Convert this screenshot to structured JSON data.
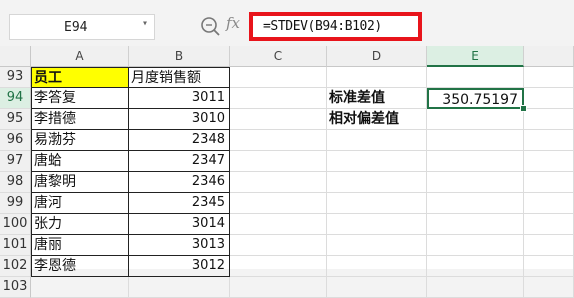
{
  "formula_bar": {
    "name_box": "E94",
    "fx_label": "fx",
    "formula": "=STDEV(B94:B102)"
  },
  "columns": [
    "A",
    "B",
    "C",
    "D",
    "E"
  ],
  "rows": [
    {
      "num": "93",
      "a": "员工",
      "b": "月度销售额",
      "d": "",
      "e": ""
    },
    {
      "num": "94",
      "a": "李答复",
      "b": "3011",
      "d": "标准差值",
      "e": "350.75197"
    },
    {
      "num": "95",
      "a": "李措德",
      "b": "3010",
      "d": "相对偏差值",
      "e": ""
    },
    {
      "num": "96",
      "a": "易渤芬",
      "b": "2348",
      "d": "",
      "e": ""
    },
    {
      "num": "97",
      "a": "唐蛤",
      "b": "2347",
      "d": "",
      "e": ""
    },
    {
      "num": "98",
      "a": "唐黎明",
      "b": "2346",
      "d": "",
      "e": ""
    },
    {
      "num": "99",
      "a": "唐河",
      "b": "2345",
      "d": "",
      "e": ""
    },
    {
      "num": "100",
      "a": "张力",
      "b": "3014",
      "d": "",
      "e": ""
    },
    {
      "num": "101",
      "a": "唐丽",
      "b": "3013",
      "d": "",
      "e": ""
    },
    {
      "num": "102",
      "a": "李恩德",
      "b": "3012",
      "d": "",
      "e": ""
    },
    {
      "num": "103",
      "a": "",
      "b": "",
      "d": "",
      "e": ""
    }
  ],
  "colors": {
    "accent": "#217346",
    "highlight": "#ffff00",
    "formula_box_border": "#e8141b"
  }
}
